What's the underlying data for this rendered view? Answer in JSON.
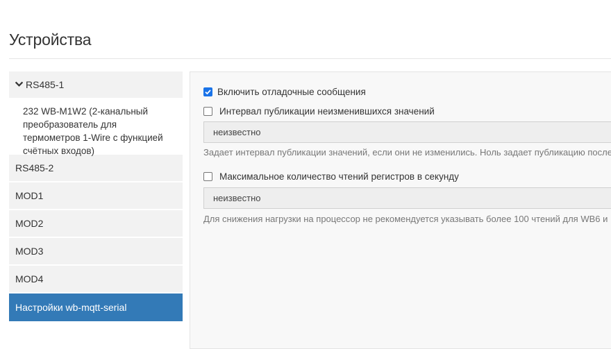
{
  "page": {
    "title": "Устройства"
  },
  "sidebar": {
    "port_expanded": {
      "label": "RS485-1",
      "icon": "chevron-down-icon"
    },
    "device": {
      "label": "232 WB-M1W2 (2-канальный преобразователь для термометров 1-Wire с функцией счётных входов)"
    },
    "ports": [
      {
        "label": "RS485-2"
      },
      {
        "label": "MOD1"
      },
      {
        "label": "MOD2"
      },
      {
        "label": "MOD3"
      },
      {
        "label": "MOD4"
      }
    ],
    "active": {
      "label": "Настройки wb-mqtt-serial"
    }
  },
  "settings": {
    "debug": {
      "label": "Включить отладочные сообщения",
      "checked": true
    },
    "publish_interval": {
      "label": "Интервал публикации неизменившихся значений",
      "checked": false,
      "value": "неизвестно",
      "help": "Задает интервал публикации значений, если они не изменились. Ноль задает публикацию после к"
    },
    "max_reads": {
      "label": "Максимальное количество чтений регистров в секунду",
      "checked": false,
      "value": "неизвестно",
      "help": "Для снижения нагрузки на процессор не рекомендуется указывать более 100 чтений для WB6 и"
    }
  },
  "colors": {
    "accent": "#337ab7",
    "checkbox": "#1a73e8",
    "sidebar_bg": "#f2f2f2",
    "panel_bg": "#f8f8f8"
  }
}
